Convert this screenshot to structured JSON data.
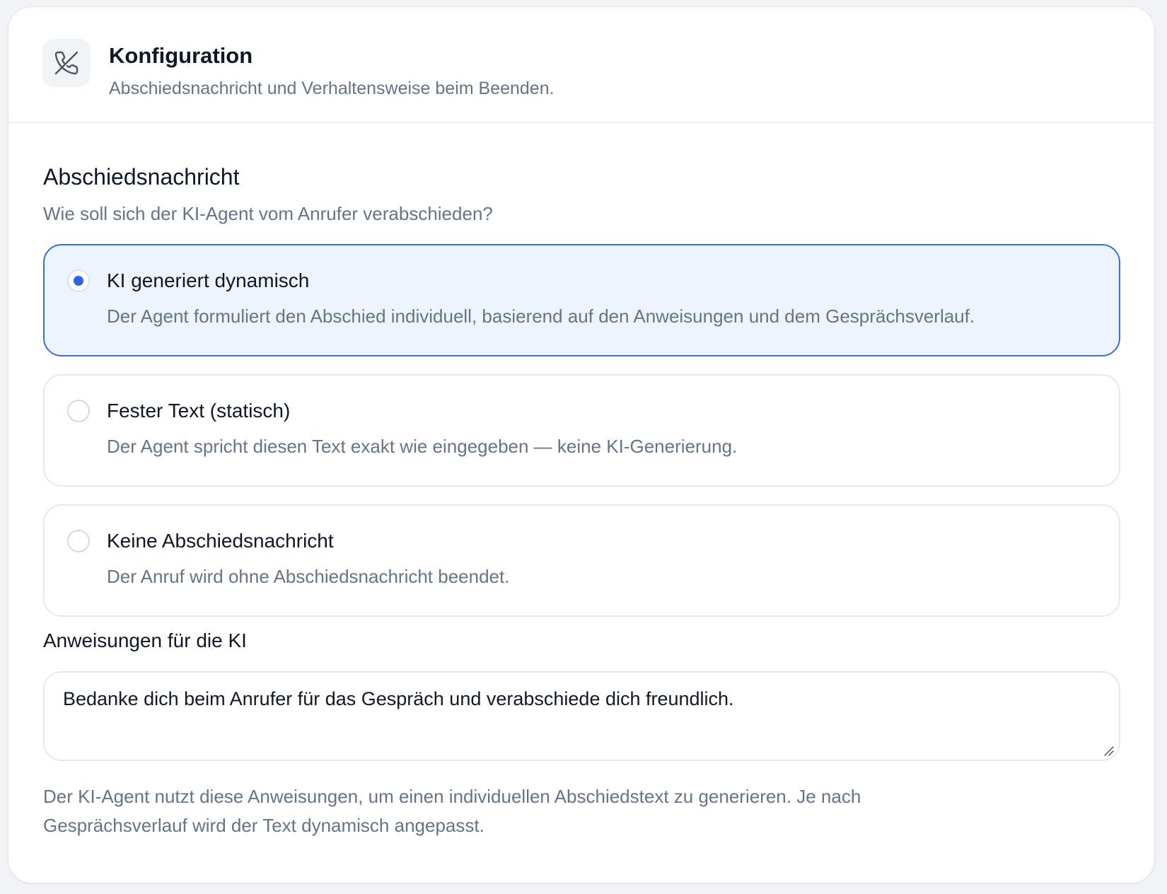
{
  "header": {
    "icon": "phone-end-icon",
    "title": "Konfiguration",
    "subtitle": "Abschiedsnachricht und Verhaltensweise beim Beenden."
  },
  "section": {
    "title": "Abschiedsnachricht",
    "subtitle": "Wie soll sich der KI-Agent vom Anrufer verabschieden?"
  },
  "options": [
    {
      "title": "KI generiert dynamisch",
      "description": "Der Agent formuliert den Abschied individuell, basierend auf den Anweisungen und dem Gesprächsverlauf.",
      "selected": true
    },
    {
      "title": "Fester Text (statisch)",
      "description": "Der Agent spricht diesen Text exakt wie eingegeben — keine KI-Generierung.",
      "selected": false
    },
    {
      "title": "Keine Abschiedsnachricht",
      "description": "Der Anruf wird ohne Abschiedsnachricht beendet.",
      "selected": false
    }
  ],
  "instructions": {
    "label": "Anweisungen für die KI",
    "value": "Bedanke dich beim Anrufer für das Gespräch und verabschiede dich freundlich.",
    "help": "Der KI-Agent nutzt diese Anweisungen, um einen individuellen Abschiedstext zu generieren. Je nach Gesprächsverlauf wird der Text dynamisch angepasst."
  },
  "colors": {
    "accent": "#2f63e6",
    "selected_border": "#3a6ee0",
    "selected_background": "#eef4fe",
    "muted_text": "#64748b"
  }
}
